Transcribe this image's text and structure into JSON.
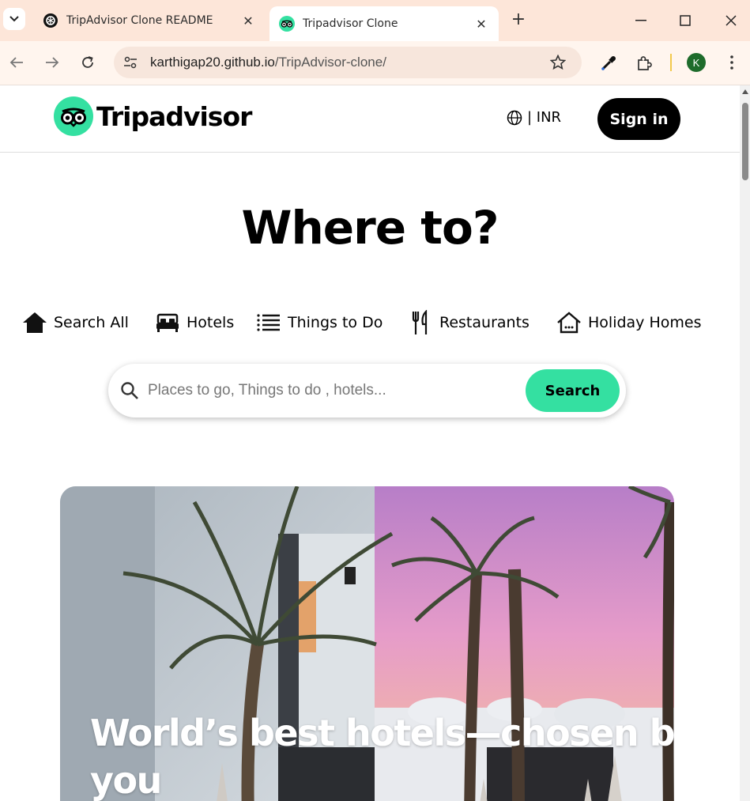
{
  "browser": {
    "tabs": [
      {
        "title": "TripAdvisor Clone README",
        "favicon": "openai-icon",
        "active": false
      },
      {
        "title": "Tripadvisor Clone",
        "favicon": "tripadvisor-owl-icon",
        "active": true
      }
    ],
    "url": {
      "host": "karthigap20.github.io",
      "path": "/TripAdvisor-clone/"
    },
    "profile_initial": "K",
    "colors": {
      "tabstrip": "#fde6d9",
      "toolbar": "#fff5ee",
      "omnibox": "#f7e6dc",
      "profile": "#1e6b2b"
    }
  },
  "site": {
    "brand": "Tripadvisor",
    "currency": "| INR",
    "signin_label": "Sign in",
    "hero_title": "Where to?",
    "categories": [
      {
        "label": "Search All",
        "icon": "house-filled-icon"
      },
      {
        "label": "Hotels",
        "icon": "bed-icon"
      },
      {
        "label": "Things to Do",
        "icon": "list-icon"
      },
      {
        "label": "Restaurants",
        "icon": "fork-knife-icon"
      },
      {
        "label": "Holiday Homes",
        "icon": "house-outline-icon"
      }
    ],
    "search": {
      "placeholder": "Places to go, Things to do , hotels...",
      "button_label": "Search"
    },
    "banner": {
      "line1": "World’s best hotels—chosen by",
      "line2": "you"
    },
    "colors": {
      "accent": "#34e0a1",
      "text": "#000000",
      "signin_bg": "#000000"
    }
  }
}
